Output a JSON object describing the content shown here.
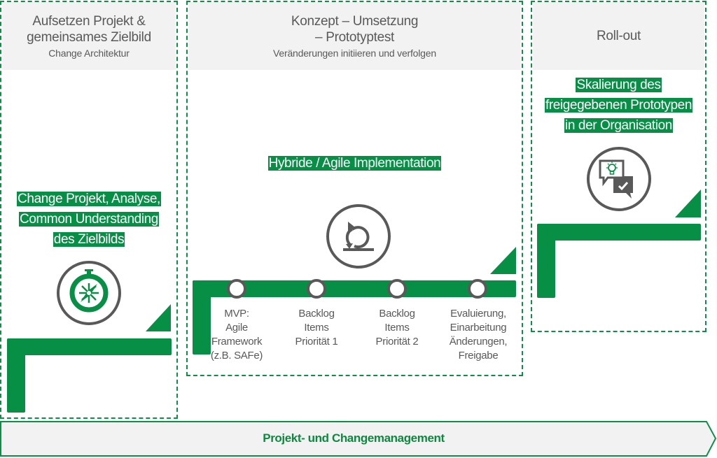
{
  "colors": {
    "accent": "#078f45",
    "header_bg": "#f2f2f2",
    "text_gray": "#595959",
    "icon_gray": "#595959"
  },
  "phases": [
    {
      "title": "Aufsetzen Projekt & gemeinsames Zielbild",
      "title_lines": [
        "Aufsetzen Projekt &",
        "gemeinsames Zielbild"
      ],
      "subtitle": "Change Architektur",
      "highlight_lines": [
        "Change Projekt, Analyse,",
        "Common Understanding",
        "des Zielbilds"
      ],
      "icon": "compass-icon"
    },
    {
      "title": "Konzept – Umsetzung – Prototyptest",
      "title_lines": [
        "Konzept – Umsetzung",
        "– Prototyptest"
      ],
      "subtitle": "Veränderungen initiieren und verfolgen",
      "highlight_lines": [
        "Hybride / Agile Implementation"
      ],
      "icon": "agile-loop-icon",
      "steps": [
        {
          "lines": [
            "MVP:",
            "Agile",
            "Framework",
            "(z.B. SAFe)"
          ]
        },
        {
          "lines": [
            "Backlog",
            "Items",
            "Priorität 1"
          ]
        },
        {
          "lines": [
            "Backlog",
            "Items",
            "Priorität 2"
          ]
        },
        {
          "lines": [
            "Evaluierung,",
            "Einarbeitung",
            "Änderungen,",
            "Freigabe"
          ]
        }
      ]
    },
    {
      "title": "Roll-out",
      "title_lines": [
        "Roll-out"
      ],
      "subtitle": "",
      "highlight_lines": [
        "Skalierung des",
        "freigegebenen Prototypen",
        "in der Organisation"
      ],
      "icon": "idea-approval-chat-icon"
    }
  ],
  "footer": {
    "label": "Projekt- und Changemanagement"
  }
}
